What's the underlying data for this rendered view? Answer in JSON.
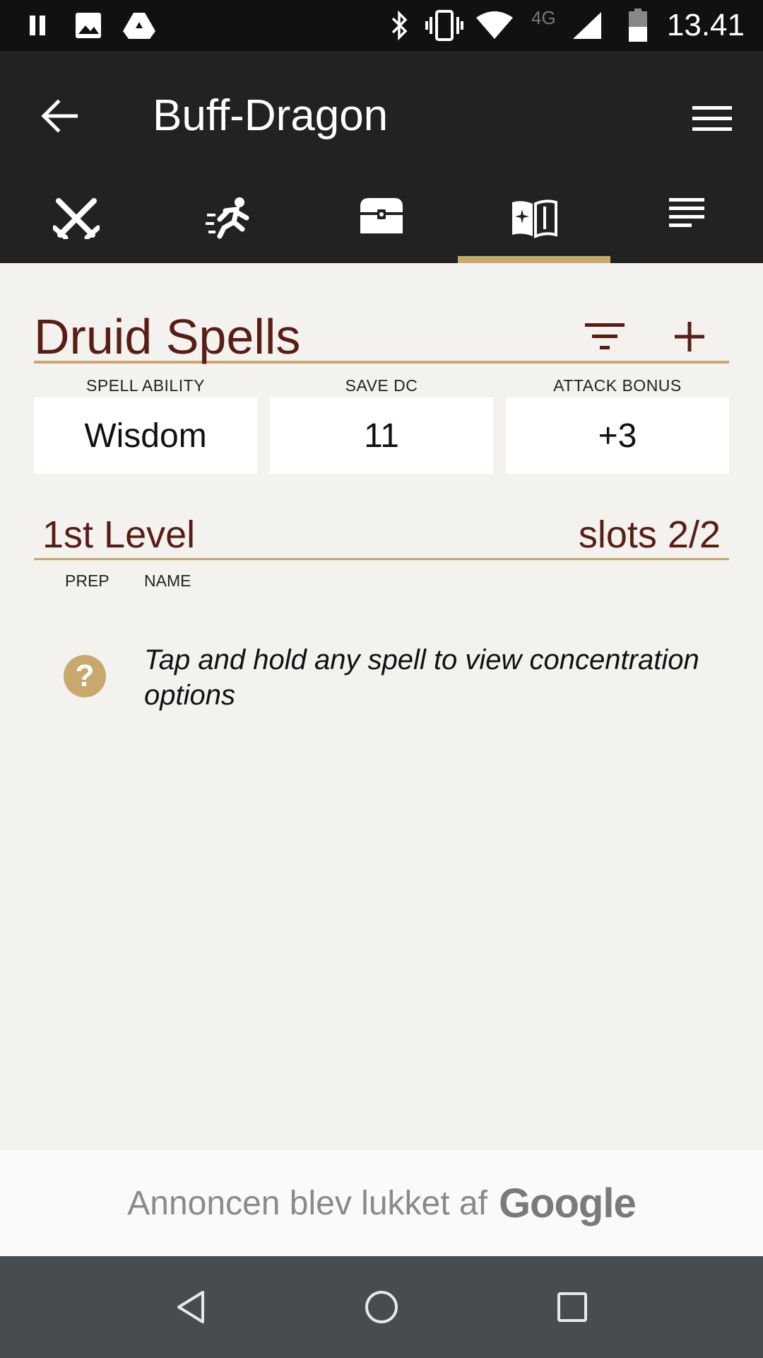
{
  "status_bar": {
    "time": "13.41",
    "network": "4G",
    "icons": [
      "pause-icon",
      "image-icon",
      "drive-icon",
      "bluetooth-icon",
      "vibrate-icon",
      "wifi-icon",
      "signal-icon",
      "battery-icon"
    ]
  },
  "app_bar": {
    "title": "Buff-Dragon",
    "back_icon": "arrow-left-icon",
    "menu_icon": "hamburger-menu-icon",
    "tabs": [
      {
        "icon": "crossed-swords-icon",
        "selected": false
      },
      {
        "icon": "running-man-icon",
        "selected": false
      },
      {
        "icon": "treasure-chest-icon",
        "selected": false
      },
      {
        "icon": "spellbook-icon",
        "selected": true
      },
      {
        "icon": "notes-lines-icon",
        "selected": false
      }
    ]
  },
  "section": {
    "title": "Druid Spells",
    "filter_icon": "filter-icon",
    "add_icon": "plus-icon"
  },
  "stats": [
    {
      "label": "SPELL ABILITY",
      "value": "Wisdom"
    },
    {
      "label": "SAVE DC",
      "value": "11"
    },
    {
      "label": "ATTACK BONUS",
      "value": "+3"
    }
  ],
  "level": {
    "title": "1st Level",
    "slots": "slots 2/2",
    "columns": {
      "prep": "PREP",
      "name": "NAME"
    }
  },
  "hint": {
    "icon": "?",
    "text": "Tap and hold any spell to view concentration options"
  },
  "ad": {
    "text": "Annoncen blev lukket af",
    "brand": "Google"
  },
  "colors": {
    "app_bar": "#222223",
    "accent": "#c9a86c",
    "heading": "#5a1d14",
    "background": "#f3f2ef"
  }
}
